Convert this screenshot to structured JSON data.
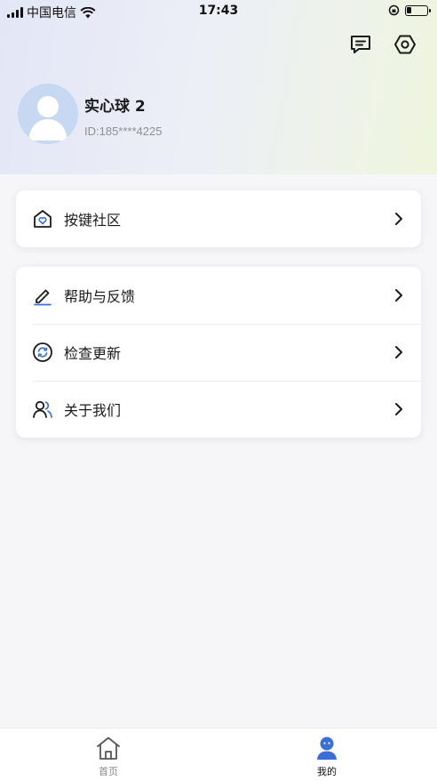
{
  "status_bar": {
    "carrier": "中国电信",
    "time": "17:43"
  },
  "profile": {
    "name": "实心球 2",
    "id_text": "ID:185****4225"
  },
  "menu_group_1": [
    {
      "label": "按键社区",
      "icon": "home-heart-icon"
    }
  ],
  "menu_group_2": [
    {
      "label": "帮助与反馈",
      "icon": "pencil-icon"
    },
    {
      "label": "检查更新",
      "icon": "refresh-icon"
    },
    {
      "label": "关于我们",
      "icon": "users-icon"
    }
  ],
  "tabbar": {
    "home": "首页",
    "mine": "我的"
  },
  "colors": {
    "accent": "#3b6fd8",
    "avatar_bg": "#c7d8f3"
  }
}
